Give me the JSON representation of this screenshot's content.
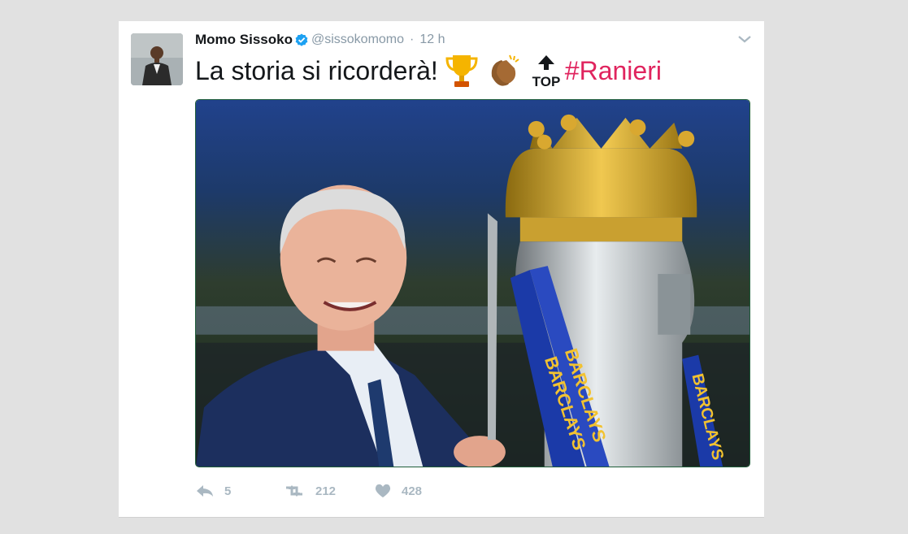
{
  "tweet": {
    "author_name": "Momo Sissoko",
    "author_handle": "@sissokomomo",
    "separator": "·",
    "time": "12 h",
    "text": "La storia si ricorderà! ",
    "hashtag": "#Ranieri",
    "emojis": [
      "trophy-emoji",
      "clapping-hands-emoji",
      "top-arrow-emoji"
    ],
    "top_label": "TOP",
    "banner_text": "BARCLAYS",
    "verified": true
  },
  "actions": {
    "replies": "5",
    "retweets": "212",
    "likes": "428"
  },
  "colors": {
    "background": "#e1e1e1",
    "card": "#ffffff",
    "hashtag": "#e0245e",
    "verified": "#1da1f2",
    "muted": "#8899a6",
    "action_icon": "#aab8c2"
  }
}
